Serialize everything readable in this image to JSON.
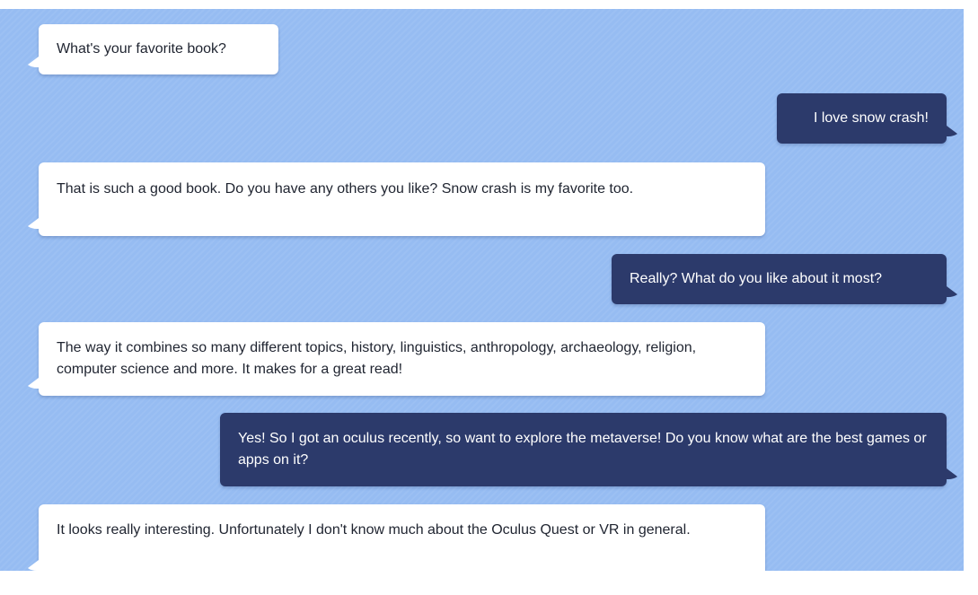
{
  "colors": {
    "background": "#96bcf2",
    "incoming_bubble": "#ffffff",
    "outgoing_bubble": "#2c3a6b",
    "incoming_text": "#1f2430",
    "outgoing_text": "#ffffff"
  },
  "chat": {
    "messages": [
      {
        "sender": "other",
        "text": "What's your favorite book?"
      },
      {
        "sender": "user",
        "text": "I love snow crash!"
      },
      {
        "sender": "other",
        "text": "That is such a good book. Do you have any others you like? Snow crash is my favorite too."
      },
      {
        "sender": "user",
        "text": "Really? What do you like about it most?"
      },
      {
        "sender": "other",
        "text": "The way it combines so many different topics, history, linguistics, anthropology, archaeology, religion, computer science and more. It makes for a great read!"
      },
      {
        "sender": "user",
        "text": "Yes! So I got an oculus recently, so want to explore the metaverse! Do you know what are the best games or apps on it?"
      },
      {
        "sender": "other",
        "text": "It looks really interesting. Unfortunately I don't know much about the Oculus Quest or VR in general."
      }
    ]
  }
}
